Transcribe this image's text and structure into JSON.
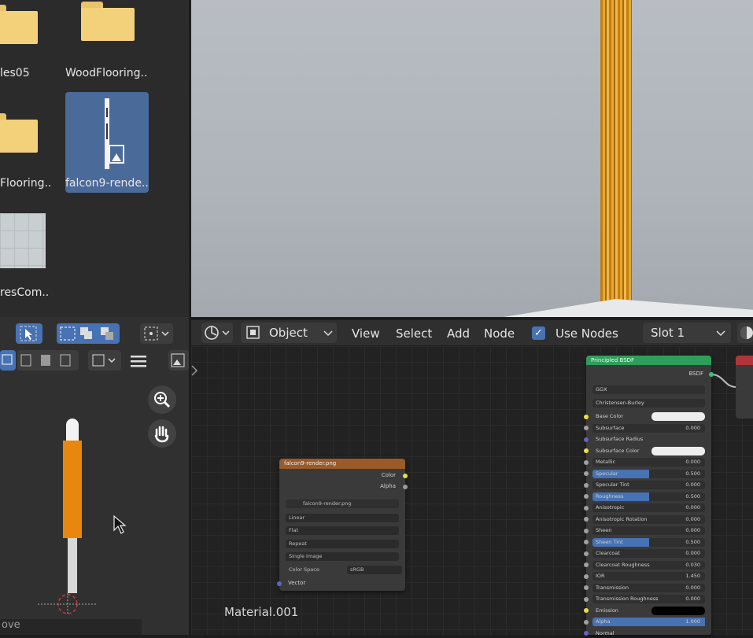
{
  "file_browser": {
    "items": [
      {
        "label": "les05"
      },
      {
        "label": "WoodFlooring.."
      },
      {
        "label": "Flooring.."
      },
      {
        "label": "falcon9-rende.."
      },
      {
        "label": "resCom.."
      }
    ]
  },
  "node_header": {
    "mode": "Object",
    "menus": [
      "View",
      "Select",
      "Add",
      "Node"
    ],
    "use_nodes_label": "Use Nodes",
    "use_nodes_checked": true,
    "slot": "Slot 1"
  },
  "image_node": {
    "title": "falcon9-render.png",
    "outputs": [
      "Color",
      "Alpha"
    ],
    "image_name": "falcon9-render.png",
    "interpolation": "Linear",
    "projection": "Flat",
    "extension": "Repeat",
    "source": "Single Image",
    "color_space_label": "Color Space",
    "color_space": "sRGB",
    "input": "Vector"
  },
  "bsdf_node": {
    "title": "Principled BSDF",
    "output": "BSDF",
    "distribution": "GGX",
    "subsurface_method": "Christensen-Burley",
    "rows": [
      {
        "label": "Base Color",
        "value": "",
        "type": "color",
        "color": "#eeeeee"
      },
      {
        "label": "Subsurface",
        "value": "0.000",
        "type": "num"
      },
      {
        "label": "Subsurface Radius",
        "value": "",
        "type": "vec"
      },
      {
        "label": "Subsurface Color",
        "value": "",
        "type": "color",
        "color": "#eeeeee"
      },
      {
        "label": "Metallic",
        "value": "0.000",
        "type": "num"
      },
      {
        "label": "Specular",
        "value": "0.500",
        "type": "num",
        "fill": 0.5
      },
      {
        "label": "Specular Tint",
        "value": "0.000",
        "type": "num"
      },
      {
        "label": "Roughness",
        "value": "0.500",
        "type": "num",
        "fill": 0.5
      },
      {
        "label": "Anisotropic",
        "value": "0.000",
        "type": "num"
      },
      {
        "label": "Anisotropic Rotation",
        "value": "0.000",
        "type": "num"
      },
      {
        "label": "Sheen",
        "value": "0.000",
        "type": "num"
      },
      {
        "label": "Sheen Tint",
        "value": "0.500",
        "type": "num",
        "fill": 0.5
      },
      {
        "label": "Clearcoat",
        "value": "0.000",
        "type": "num"
      },
      {
        "label": "Clearcoat Roughness",
        "value": "0.030",
        "type": "num"
      },
      {
        "label": "IOR",
        "value": "1.450",
        "type": "num"
      },
      {
        "label": "Transmission",
        "value": "0.000",
        "type": "num"
      },
      {
        "label": "Transmission Roughness",
        "value": "0.000",
        "type": "num"
      },
      {
        "label": "Emission",
        "value": "",
        "type": "color",
        "color": "#000000"
      },
      {
        "label": "Alpha",
        "value": "1.000",
        "type": "num",
        "fill": 1.0
      },
      {
        "label": "Normal",
        "value": "",
        "type": "vec"
      }
    ]
  },
  "material_name": "Material.001",
  "status_text": "ove",
  "colors": {
    "accent": "#4772b3",
    "folder": "#f3d17a",
    "image_node_header": "#9a5a2a",
    "bsdf_header": "#2f9e5a",
    "output_header": "#b0343a",
    "rocket": "#e8870e"
  }
}
